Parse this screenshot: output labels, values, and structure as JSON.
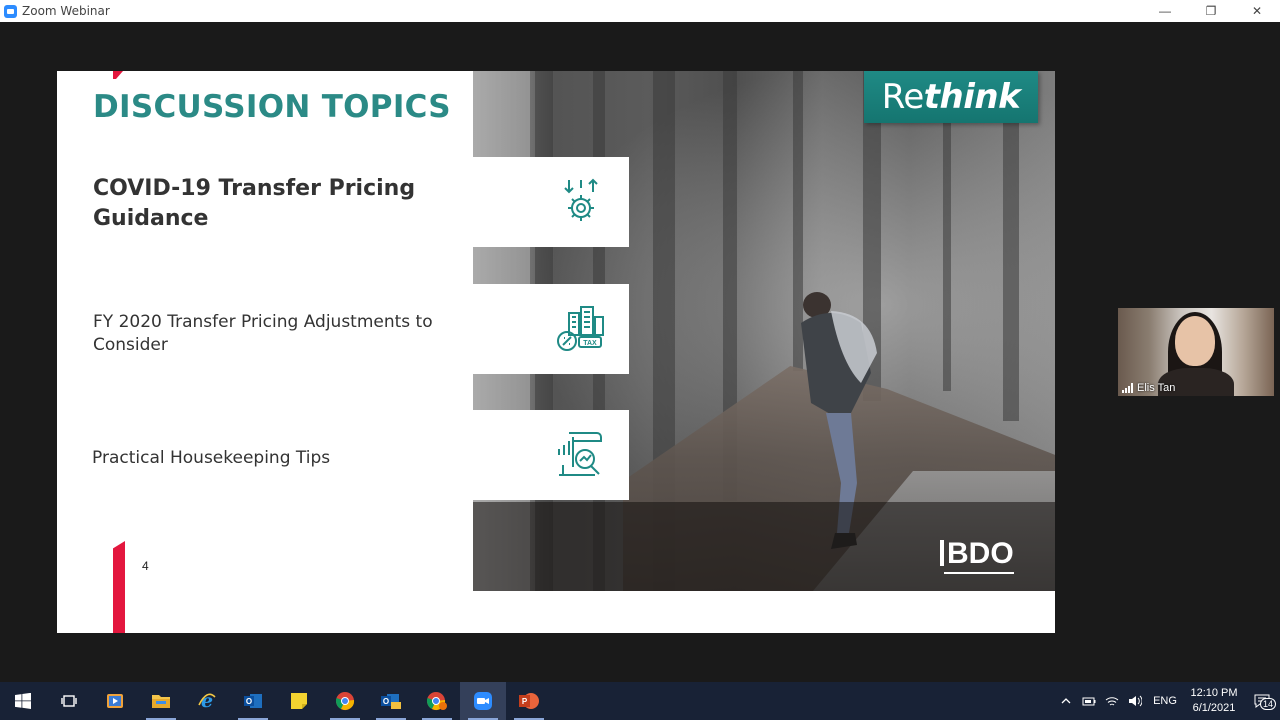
{
  "window": {
    "title": "Zoom Webinar",
    "controls": {
      "minimize": "—",
      "restore": "❐",
      "close": "✕"
    }
  },
  "slide": {
    "heading": "DISCUSSION TOPICS",
    "topics": [
      {
        "label": "COVID-19 Transfer Pricing Guidance",
        "icon": "gear-arrows-icon"
      },
      {
        "label": "FY 2020 Transfer Pricing Adjustments to Consider",
        "icon": "tax-building-icon"
      },
      {
        "label": "Practical Housekeeping Tips",
        "icon": "document-magnifier-icon"
      }
    ],
    "badge_prefix": "Re",
    "badge_emph": "think",
    "brand": "BDO",
    "page_number": "4",
    "accent_color": "#2b8a86",
    "brand_red": "#e3173e"
  },
  "participant": {
    "name": "Elis Tan"
  },
  "taskbar": {
    "items": [
      "windows-start-icon",
      "task-view-icon",
      "media-app-icon",
      "file-explorer-icon",
      "internet-explorer-icon",
      "outlook-icon",
      "sticky-notes-icon",
      "chrome-icon",
      "outlook-mail-icon",
      "chrome-alt-icon",
      "zoom-icon",
      "powerpoint-icon"
    ],
    "tray": {
      "language": "ENG",
      "time": "12:10 PM",
      "date": "6/1/2021",
      "notifications": "14"
    }
  }
}
